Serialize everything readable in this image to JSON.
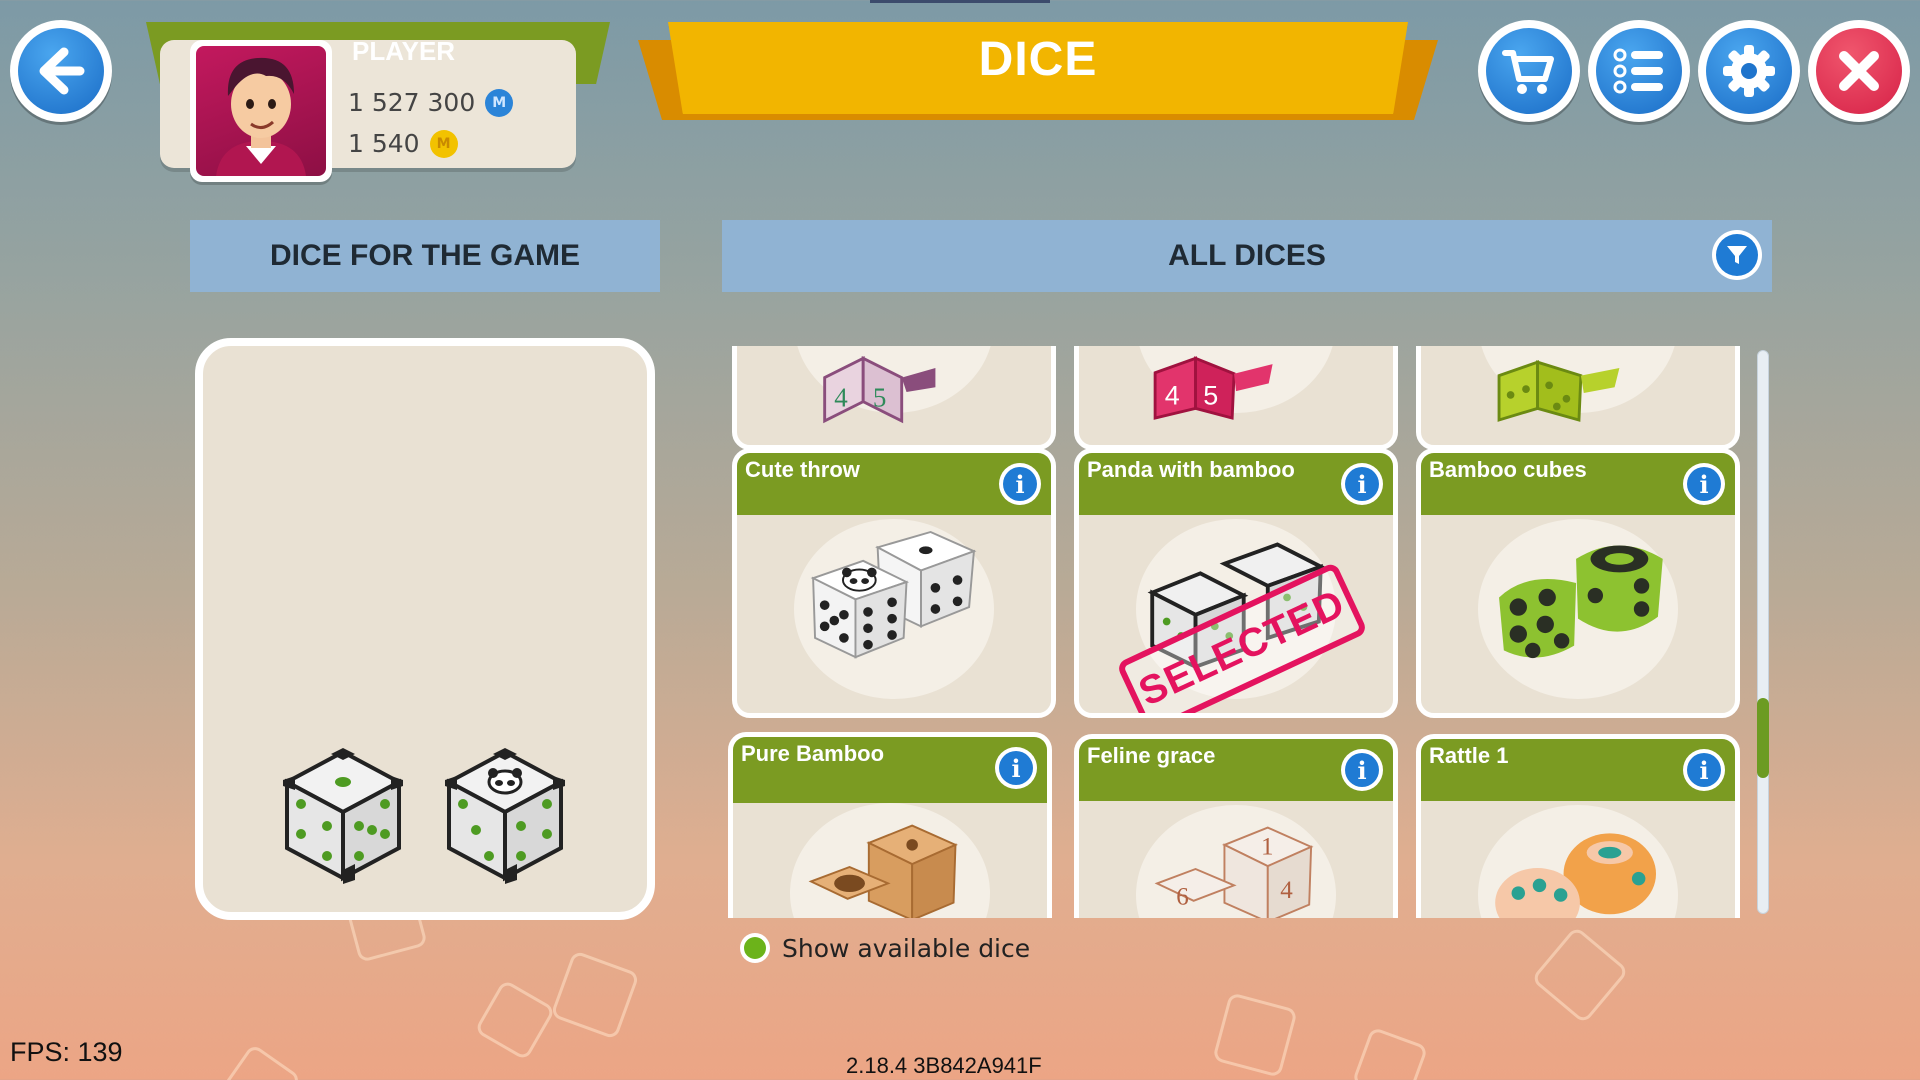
{
  "header": {
    "title": "DICE",
    "player": {
      "name": "PLAYER",
      "gems": "1 527 300",
      "coins": "1 540"
    },
    "buttons": {
      "back_icon": "arrow-left-icon",
      "shop_icon": "cart-icon",
      "tasks_icon": "checklist-icon",
      "settings_icon": "gear-icon",
      "close_icon": "close-icon"
    }
  },
  "left_panel": {
    "header": "DICE FOR THE GAME",
    "selected_dice": [
      {
        "name": "panda-dice-1",
        "icon": "cube-dots-icon"
      },
      {
        "name": "panda-dice-2",
        "icon": "cube-panda-icon"
      }
    ]
  },
  "right_panel": {
    "header": "ALL DICES",
    "filter_icon": "filter-icon",
    "cards": [
      {
        "name": "",
        "art": "number-dice-violet"
      },
      {
        "name": "",
        "art": "number-dice-pink"
      },
      {
        "name": "",
        "art": "lime-dice"
      },
      {
        "name": "Cute throw",
        "art": "white-panda-dice"
      },
      {
        "name": "Panda with bamboo",
        "art": "panda-bamboo-dice",
        "badge": "SELECTED"
      },
      {
        "name": "Bamboo cubes",
        "art": "green-leaf-dice"
      },
      {
        "name": "Pure Bamboo",
        "art": "wooden-dice"
      },
      {
        "name": "Feline grace",
        "art": "white-number-dice"
      },
      {
        "name": "Rattle 1",
        "art": "orange-dot-dice"
      }
    ],
    "info_label": "i"
  },
  "footer": {
    "show_available_label": "Show available dice",
    "fps": "FPS: 139",
    "version": "2.18.4 3B842A941F"
  },
  "colors": {
    "green": "#7b9b22",
    "blue": "#1f7bd4",
    "yellow": "#f2b500",
    "red": "#d62147",
    "selected": "#e4135f"
  }
}
